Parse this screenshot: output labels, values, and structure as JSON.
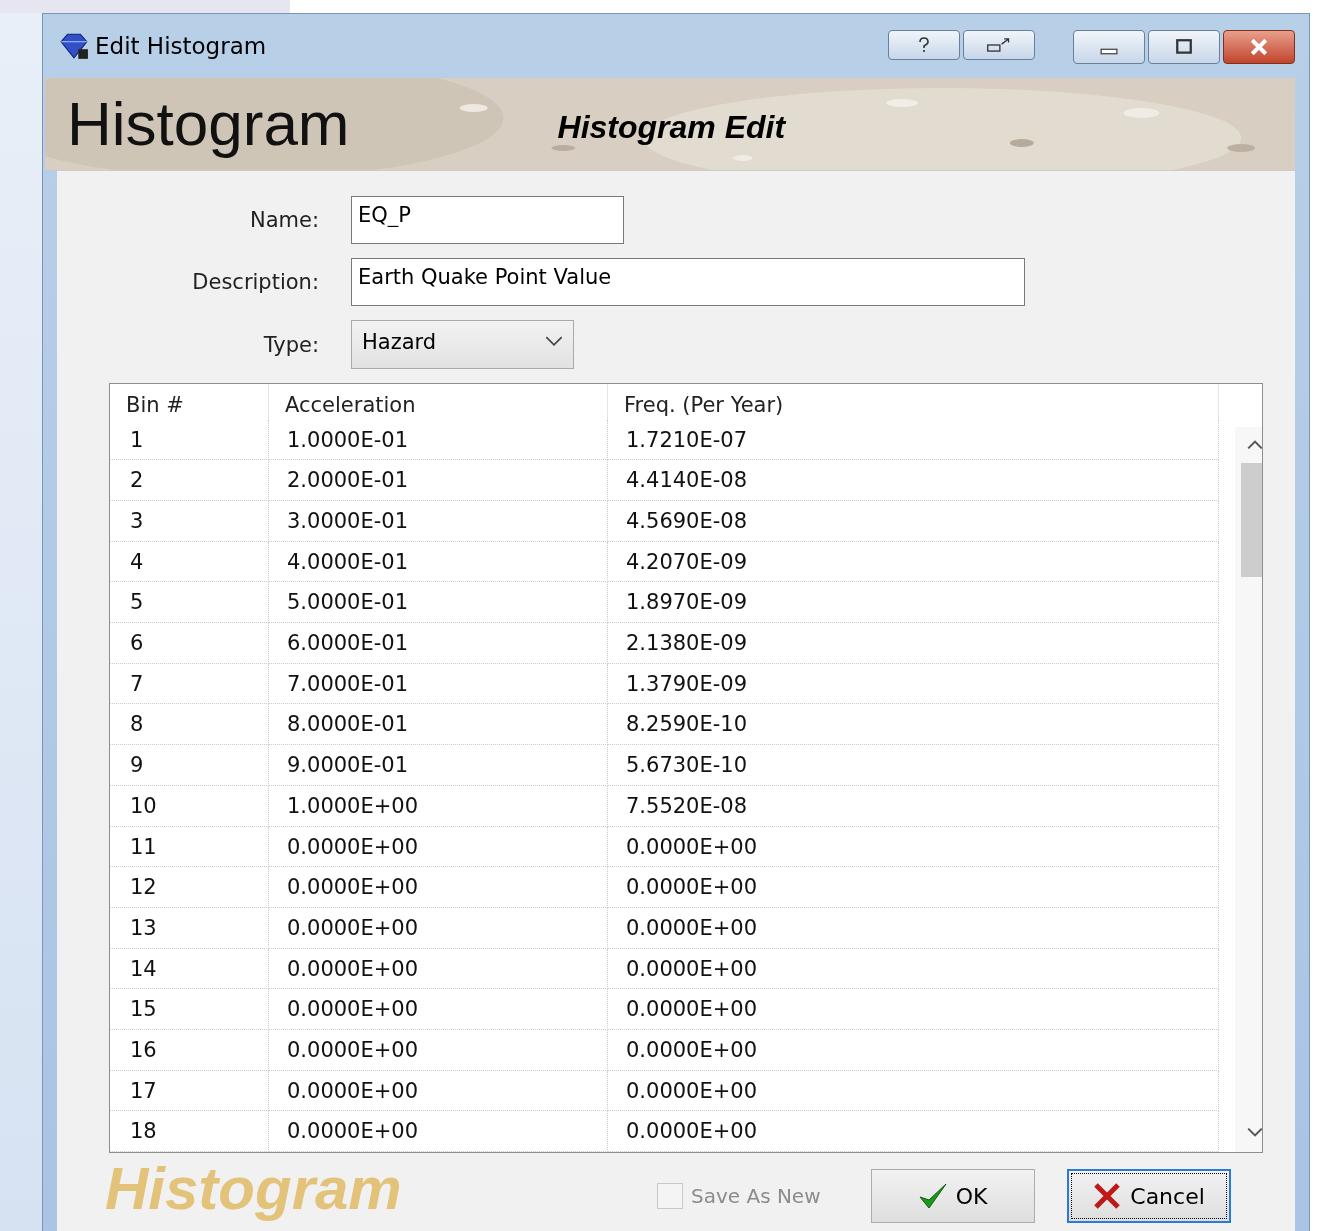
{
  "window": {
    "title": "Edit Histogram"
  },
  "banner": {
    "title": "Histogram",
    "subtitle": "Histogram Edit"
  },
  "form": {
    "name_label": "Name:",
    "name": "EQ_P",
    "description_label": "Description:",
    "description": "Earth Quake Point Value",
    "type_label": "Type:",
    "type": "Hazard"
  },
  "table": {
    "columns": [
      "Bin #",
      "Acceleration",
      "Freq. (Per Year)"
    ],
    "rows": [
      [
        "1",
        "1.0000E-01",
        "1.7210E-07"
      ],
      [
        "2",
        "2.0000E-01",
        "4.4140E-08"
      ],
      [
        "3",
        "3.0000E-01",
        "4.5690E-08"
      ],
      [
        "4",
        "4.0000E-01",
        "4.2070E-09"
      ],
      [
        "5",
        "5.0000E-01",
        "1.8970E-09"
      ],
      [
        "6",
        "6.0000E-01",
        "2.1380E-09"
      ],
      [
        "7",
        "7.0000E-01",
        "1.3790E-09"
      ],
      [
        "8",
        "8.0000E-01",
        "8.2590E-10"
      ],
      [
        "9",
        "9.0000E-01",
        "5.6730E-10"
      ],
      [
        "10",
        "1.0000E+00",
        "7.5520E-08"
      ],
      [
        "11",
        "0.0000E+00",
        "0.0000E+00"
      ],
      [
        "12",
        "0.0000E+00",
        "0.0000E+00"
      ],
      [
        "13",
        "0.0000E+00",
        "0.0000E+00"
      ],
      [
        "14",
        "0.0000E+00",
        "0.0000E+00"
      ],
      [
        "15",
        "0.0000E+00",
        "0.0000E+00"
      ],
      [
        "16",
        "0.0000E+00",
        "0.0000E+00"
      ],
      [
        "17",
        "0.0000E+00",
        "0.0000E+00"
      ],
      [
        "18",
        "0.0000E+00",
        "0.0000E+00"
      ]
    ]
  },
  "footer": {
    "background_text": "Histogram",
    "save_as_new": {
      "label": "Save As New",
      "checked": false,
      "disabled": true
    },
    "ok": "OK",
    "cancel": {
      "label": "Cancel",
      "selected": true
    }
  }
}
